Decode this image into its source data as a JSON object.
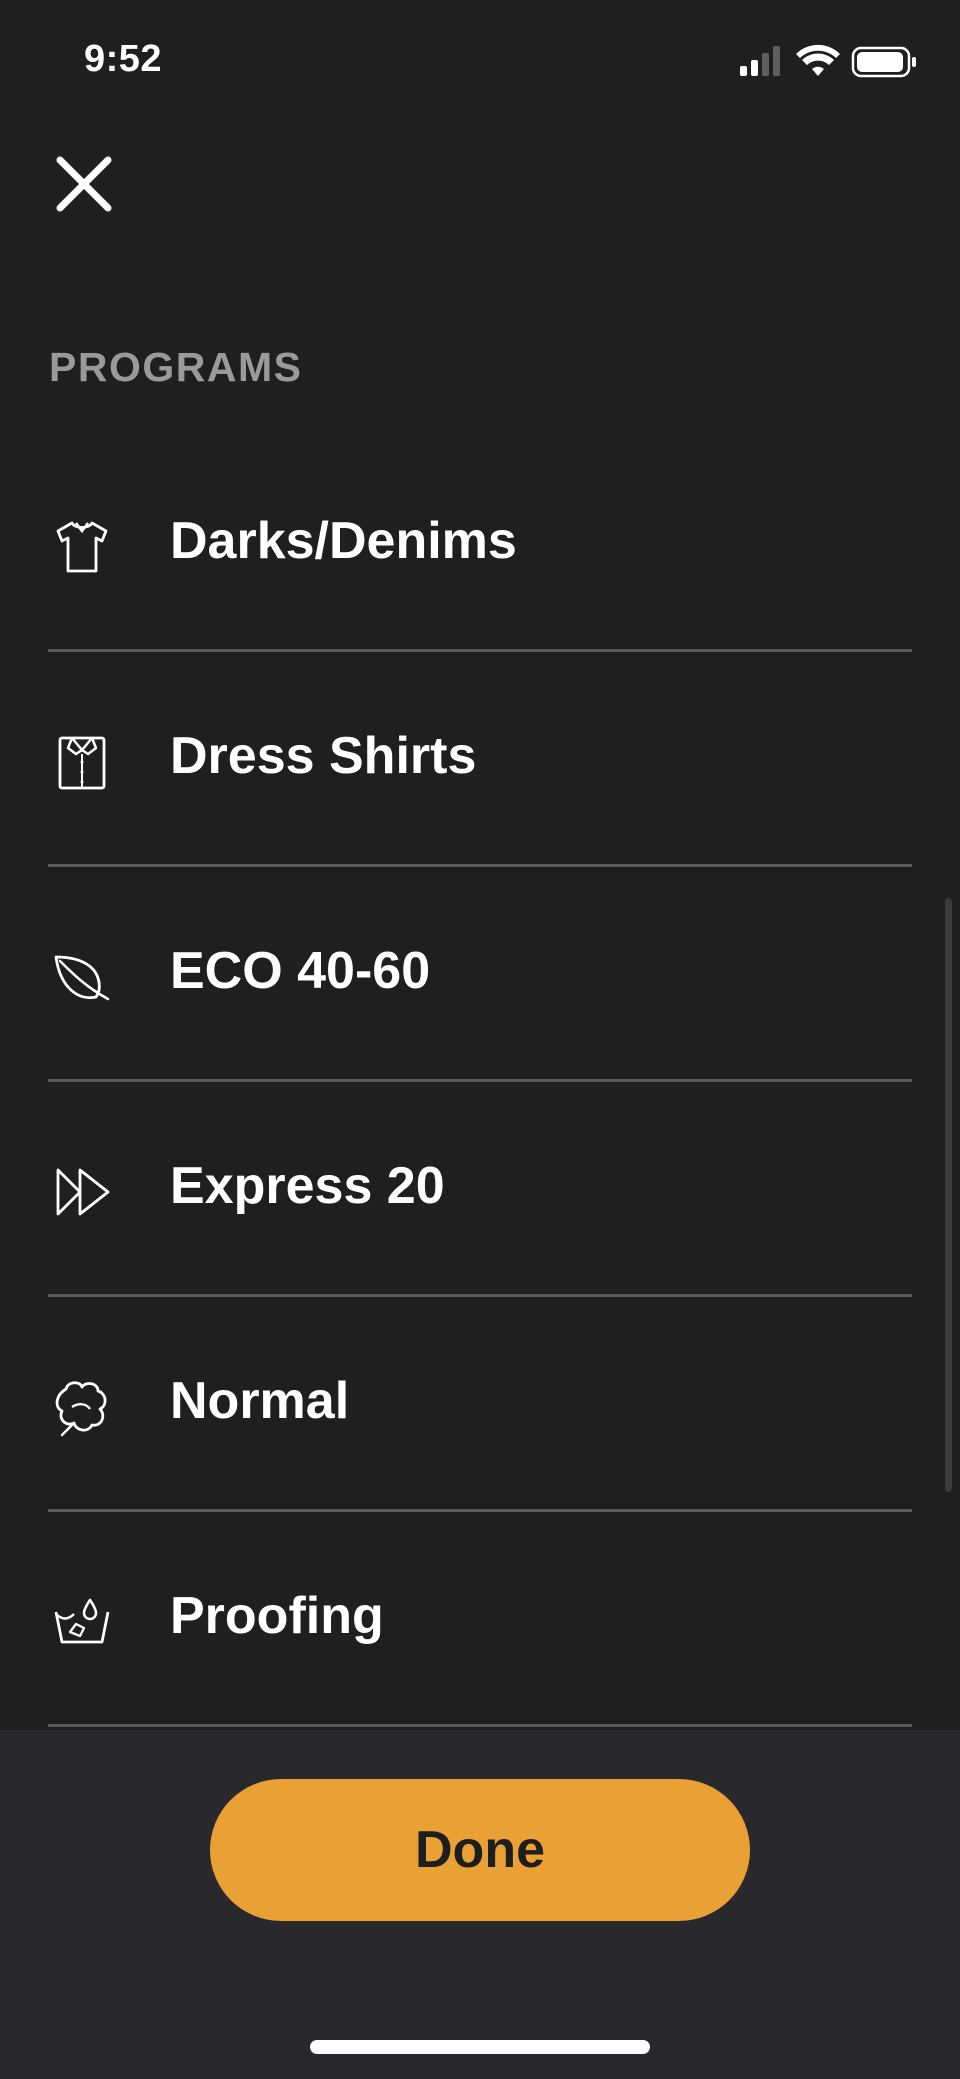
{
  "status_bar": {
    "time": "9:52",
    "icons": [
      "cellular-signal-icon",
      "wifi-icon",
      "battery-icon"
    ]
  },
  "header": {
    "close_icon": "close-icon"
  },
  "section": {
    "title": "PROGRAMS"
  },
  "programs": [
    {
      "label": "Darks/Denims",
      "icon": "tshirt-icon"
    },
    {
      "label": "Dress Shirts",
      "icon": "dress-shirt-icon"
    },
    {
      "label": "ECO 40-60",
      "icon": "leaf-icon"
    },
    {
      "label": "Express 20",
      "icon": "fast-forward-icon"
    },
    {
      "label": "Normal",
      "icon": "cotton-icon"
    },
    {
      "label": "Proofing",
      "icon": "wash-basin-drop-icon"
    }
  ],
  "footer": {
    "done_label": "Done"
  },
  "colors": {
    "background": "#1f1f20",
    "footer_background": "#29292d",
    "accent": "#e9a035",
    "section_title": "#9a9a9a",
    "divider": "#5a5a5a"
  }
}
